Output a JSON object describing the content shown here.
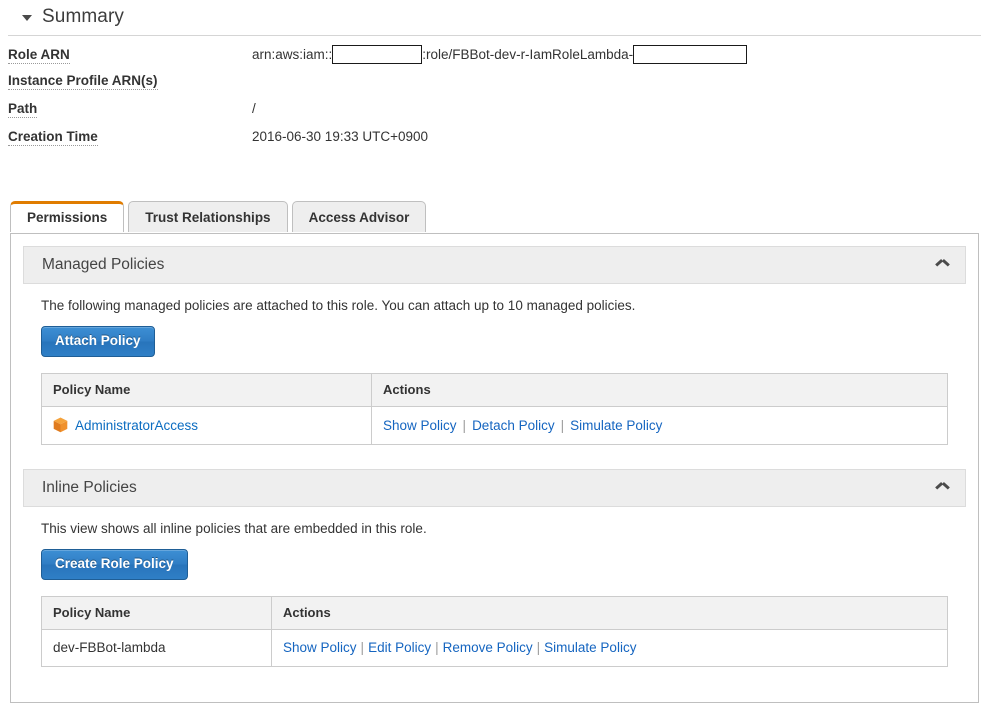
{
  "summary": {
    "title": "Summary",
    "collapse_icon": "caret-down-icon",
    "rows": [
      {
        "label": "Role ARN",
        "value_prefix": "arn:aws:iam::",
        "value_middle": ":role/FBBot-dev-r-IamRoleLambda-",
        "value_suffix": "",
        "redacted": true
      },
      {
        "label": "Instance Profile ARN(s)",
        "value": ""
      },
      {
        "label": "Path",
        "value": "/"
      },
      {
        "label": "Creation Time",
        "value": "2016-06-30 19:33 UTC+0900"
      }
    ]
  },
  "tabs": [
    {
      "label": "Permissions",
      "active": true
    },
    {
      "label": "Trust Relationships",
      "active": false
    },
    {
      "label": "Access Advisor",
      "active": false
    }
  ],
  "managed_policies": {
    "section_title": "Managed Policies",
    "chevron_icon": "chevron-up-icon",
    "description": "The following managed policies are attached to this role. You can attach up to 10 managed policies.",
    "button_label": "Attach Policy",
    "columns": [
      "Policy Name",
      "Actions"
    ],
    "rows": [
      {
        "policy_name": "AdministratorAccess",
        "icon": "policy-cube-icon",
        "actions": [
          "Show Policy",
          "Detach Policy",
          "Simulate Policy"
        ]
      }
    ]
  },
  "inline_policies": {
    "section_title": "Inline Policies",
    "chevron_icon": "chevron-up-icon",
    "description": "This view shows all inline policies that are embedded in this role.",
    "button_label": "Create Role Policy",
    "columns": [
      "Policy Name",
      "Actions"
    ],
    "rows": [
      {
        "policy_name": "dev-FBBot-lambda",
        "actions": [
          "Show Policy",
          "Edit Policy",
          "Remove Policy",
          "Simulate Policy"
        ]
      }
    ]
  },
  "colors": {
    "accent_orange": "#e07c00",
    "link_blue": "#1565c0",
    "button_blue": "#2f7dc4",
    "policy_icon_orange": "#f0932b"
  }
}
